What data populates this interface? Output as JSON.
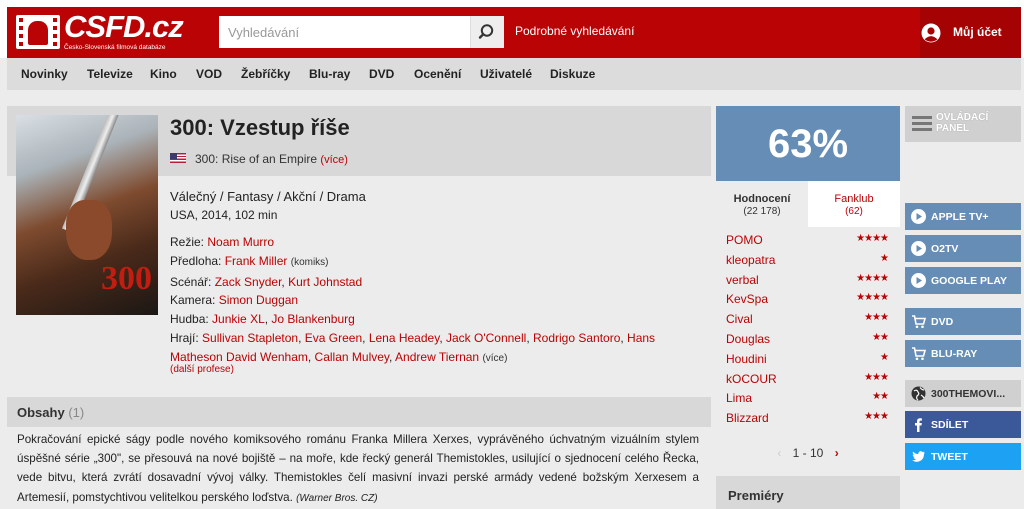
{
  "header": {
    "logo_text": "CSFD.cz",
    "logo_subtitle": "Česko-Slovenská filmová databáze",
    "search_placeholder": "Vyhledávání",
    "advanced_search": "Podrobné vyhledávání",
    "account_label": "Můj účet"
  },
  "nav": [
    "Novinky",
    "Televize",
    "Kino",
    "VOD",
    "Žebříčky",
    "Blu-ray",
    "DVD",
    "Ocenění",
    "Uživatelé",
    "Diskuze"
  ],
  "film": {
    "title": "300: Vzestup říše",
    "original_title": "300: Rise of an Empire",
    "original_more": "(více)",
    "genres": "Válečný / Fantasy / Akční / Drama",
    "origin": "USA, 2014, 102 min",
    "credits": [
      {
        "role": "Režie:",
        "people": [
          "Noam Murro"
        ]
      },
      {
        "role": "Předloha:",
        "people": [
          "Frank Miller"
        ],
        "note": "(komiks)"
      },
      {
        "role": "Scénář:",
        "people": [
          "Zack Snyder",
          "Kurt Johnstad"
        ]
      },
      {
        "role": "Kamera:",
        "people": [
          "Simon Duggan"
        ]
      },
      {
        "role": "Hudba:",
        "people": [
          "Junkie XL",
          "Jo Blankenburg"
        ]
      },
      {
        "role": "Hrají:",
        "people": [
          "Sullivan Stapleton",
          "Eva Green",
          "Lena Headey",
          "Jack O'Connell",
          "Rodrigo Santoro",
          "Hans Matheson",
          "David Wenham",
          "Callan Mulvey",
          "Andrew Tiernan"
        ],
        "note": "(více)"
      }
    ],
    "other_professions": "(další profese)",
    "poster_text": "300"
  },
  "plot": {
    "heading": "Obsahy",
    "count": "(1)",
    "text": "Pokračování epické ságy podle nového komiksového románu Franka Millera Xerxes, vyprávěného úchvatným vizuálním stylem úspěšné série „300\", se přesouvá na nové bojiště – na moře, kde řecký generál Themistokles, usilující o sjednocení celého Řecka, vede bitvu, která zvrátí dosavadní vývoj války. Themistokles čelí masivní invazi perské armády vedené božským Xerxesem a Artemesií, pomstychtivou velitelkou perského loďstva.",
    "source": "(Warner Bros. CZ)"
  },
  "rating": {
    "percent": "63%",
    "tab_ratings_label": "Hodnocení",
    "tab_ratings_count": "(22 178)",
    "tab_fanclub_label": "Fanklub",
    "tab_fanclub_count": "(62)",
    "users": [
      {
        "name": "POMO",
        "stars": 4
      },
      {
        "name": "kleopatra",
        "stars": 1
      },
      {
        "name": "verbal",
        "stars": 4
      },
      {
        "name": "KevSpa",
        "stars": 4
      },
      {
        "name": "Cival",
        "stars": 3
      },
      {
        "name": "Douglas",
        "stars": 2
      },
      {
        "name": "Houdini",
        "stars": 1
      },
      {
        "name": "kOCOUR",
        "stars": 3
      },
      {
        "name": "Lima",
        "stars": 2
      },
      {
        "name": "Blizzard",
        "stars": 3
      }
    ],
    "pager": "1 - 10",
    "premiery": "Premiéry"
  },
  "sidebar": {
    "control_panel": "OVLÁDACÍ PANEL",
    "buttons": [
      {
        "label": "APPLE TV+",
        "icon": "play-icon"
      },
      {
        "label": "O2TV",
        "icon": "play-icon"
      },
      {
        "label": "GOOGLE PLAY",
        "icon": "play-icon"
      },
      {
        "label": "DVD",
        "icon": "cart-icon"
      },
      {
        "label": "BLU-RAY",
        "icon": "cart-icon"
      },
      {
        "label": "300THEMOVI...",
        "icon": "globe-icon"
      },
      {
        "label": "SDÍLET",
        "icon": "facebook-icon"
      },
      {
        "label": "TWEET",
        "icon": "twitter-icon"
      }
    ]
  },
  "colors": {
    "brand_red": "#ba0305",
    "rating_blue": "#658db5",
    "facebook": "#3b5998",
    "twitter": "#1da1f2"
  }
}
